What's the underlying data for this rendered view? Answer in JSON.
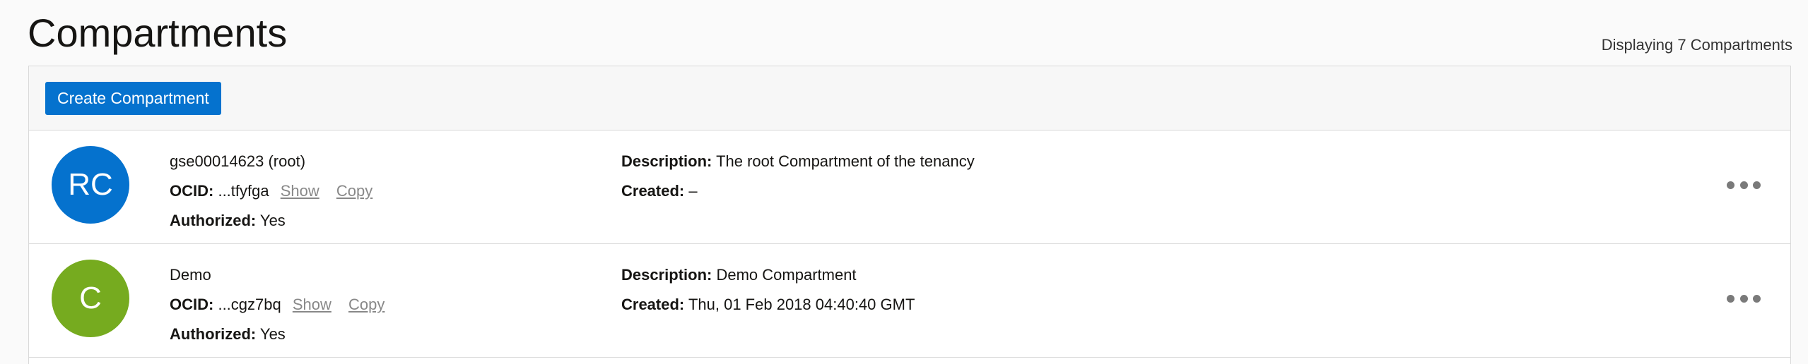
{
  "header": {
    "title": "Compartments",
    "count_text": "Displaying 7 Compartments"
  },
  "toolbar": {
    "create_label": "Create Compartment"
  },
  "labels": {
    "ocid": "OCID:",
    "authorized": "Authorized:",
    "description": "Description:",
    "created": "Created:",
    "show": "Show",
    "copy": "Copy"
  },
  "compartments": [
    {
      "initials": "RC",
      "avatar_color": "#0572ce",
      "name": "gse00014623 (root)",
      "ocid": "...tfyfga",
      "authorized": "Yes",
      "description": "The root Compartment of the tenancy",
      "created": "–"
    },
    {
      "initials": "C",
      "avatar_color": "#76ab1f",
      "name": "Demo",
      "ocid": "...cgz7bq",
      "authorized": "Yes",
      "description": "Demo Compartment",
      "created": "Thu, 01 Feb 2018 04:40:40 GMT"
    }
  ]
}
